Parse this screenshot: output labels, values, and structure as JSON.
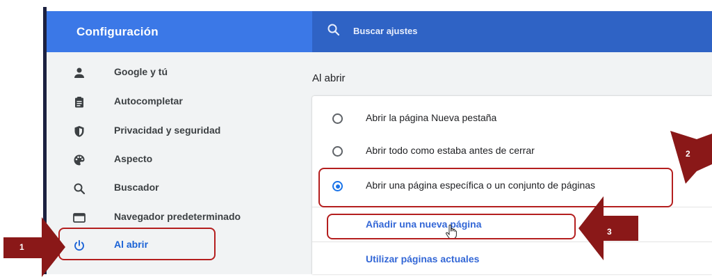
{
  "header": {
    "title": "Configuración",
    "search_placeholder": "Buscar ajustes"
  },
  "sidebar": {
    "items": [
      {
        "label": "Google y tú",
        "icon": "person-icon"
      },
      {
        "label": "Autocompletar",
        "icon": "clipboard-icon"
      },
      {
        "label": "Privacidad y seguridad",
        "icon": "shield-icon"
      },
      {
        "label": "Aspecto",
        "icon": "palette-icon"
      },
      {
        "label": "Buscador",
        "icon": "search-icon"
      },
      {
        "label": "Navegador predeterminado",
        "icon": "browser-window-icon"
      },
      {
        "label": "Al abrir",
        "icon": "power-icon",
        "active": true
      }
    ]
  },
  "startup": {
    "section_title": "Al abrir",
    "options": [
      {
        "label": "Abrir la página Nueva pestaña",
        "checked": false
      },
      {
        "label": "Abrir todo como estaba antes de cerrar",
        "checked": false
      },
      {
        "label": "Abrir una página específica o un conjunto de páginas",
        "checked": true
      }
    ],
    "add_page_link": "Añadir una nueva página",
    "use_current_link": "Utilizar páginas actuales"
  },
  "annotations": {
    "step1": "1",
    "step2": "2",
    "step3": "3",
    "color": "#b41e1e"
  },
  "colors": {
    "header": "#3b78e7",
    "search_bar": "#2f63c5",
    "accent": "#1a73e8",
    "sidebar_bg": "#f1f3f4"
  }
}
